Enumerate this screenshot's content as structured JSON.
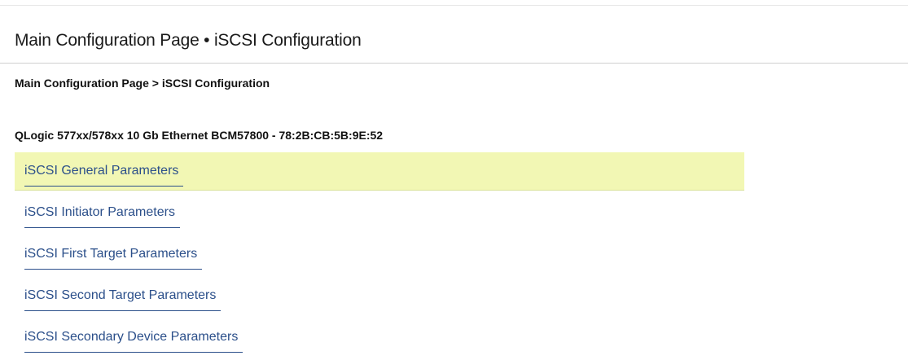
{
  "header": {
    "title": "Main Configuration Page • iSCSI Configuration"
  },
  "breadcrumb": {
    "text": "Main Configuration Page > iSCSI Configuration"
  },
  "device": {
    "title": "QLogic 577xx/578xx 10 Gb Ethernet BCM57800 - 78:2B:CB:5B:9E:52"
  },
  "menu": {
    "selected_index": 0,
    "highlight_color": "#f2f7b4",
    "link_color": "#2b4f8a",
    "items": [
      {
        "label": "iSCSI General Parameters"
      },
      {
        "label": "iSCSI Initiator Parameters"
      },
      {
        "label": "iSCSI First Target Parameters"
      },
      {
        "label": "iSCSI Second Target Parameters"
      },
      {
        "label": "iSCSI Secondary Device Parameters"
      }
    ]
  }
}
